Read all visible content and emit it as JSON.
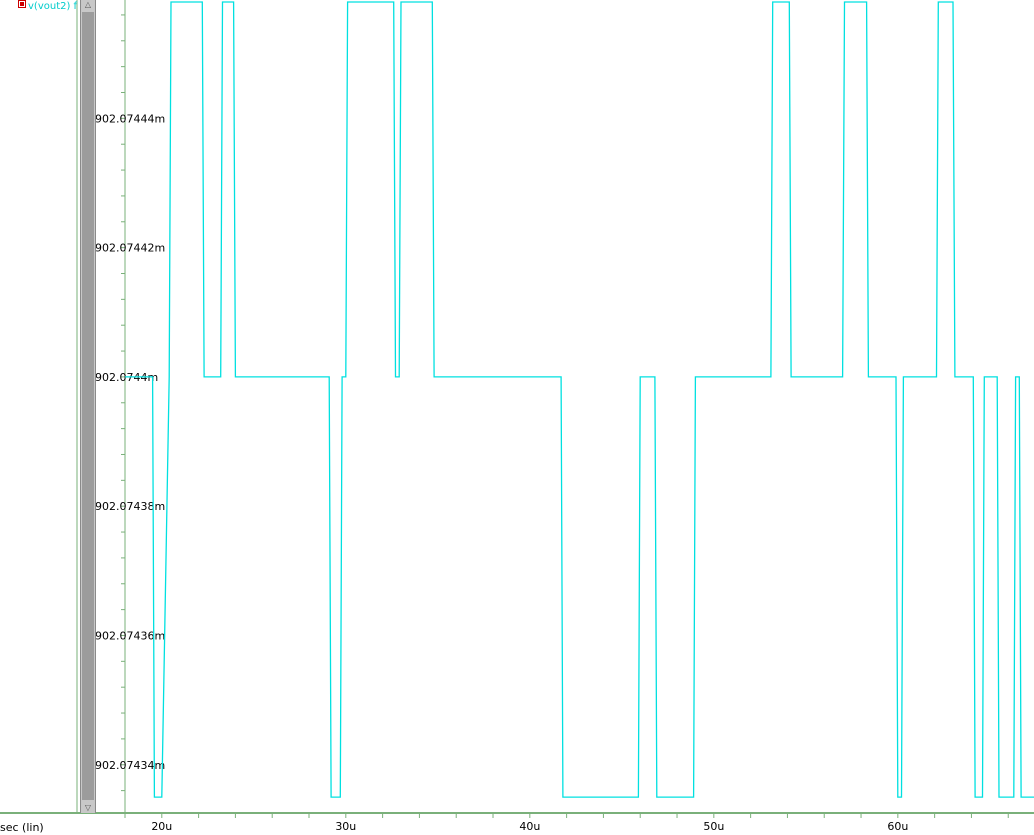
{
  "legend": {
    "label": "v(vout2) f"
  },
  "chart_data": {
    "type": "line",
    "title": "",
    "xlabel": "sec (lin)",
    "ylabel": "",
    "x_unit": "u",
    "y_unit": "m",
    "xlim": [
      18.0,
      67.4
    ],
    "ylim": [
      902.074333,
      902.074458
    ],
    "grid": false,
    "xticks": [
      20,
      30,
      40,
      50,
      60
    ],
    "xtick_labels": [
      "20u",
      "30u",
      "40u",
      "50u",
      "60u"
    ],
    "yticks": [
      902.07434,
      902.07436,
      902.07438,
      902.0744,
      902.07442,
      902.07444
    ],
    "ytick_labels": [
      "902.07434m",
      "902.07436m",
      "902.07438m",
      "902.0744m",
      "902.07442m",
      "902.07444m"
    ],
    "colors": {
      "series": "#00e0e0",
      "axis": "#7ab07a",
      "marker": "#cc0000"
    },
    "series": [
      {
        "name": "v(vout2)",
        "levels": [
          902.074458,
          902.0744,
          902.074335
        ],
        "x": [
          18.0,
          19.5,
          19.6,
          20.0,
          20.4,
          20.5,
          22.2,
          22.3,
          23.2,
          23.3,
          23.9,
          24.0,
          29.1,
          29.2,
          29.7,
          29.8,
          30.0,
          30.1,
          32.6,
          32.7,
          32.9,
          33.0,
          34.7,
          34.8,
          41.7,
          41.8,
          45.9,
          46.0,
          46.8,
          46.9,
          48.9,
          49.0,
          53.1,
          53.2,
          54.1,
          54.2,
          57.0,
          57.1,
          58.3,
          58.4,
          59.9,
          60.0,
          60.2,
          60.3,
          62.1,
          62.2,
          63.0,
          63.1,
          64.1,
          64.2,
          64.6,
          64.7,
          65.4,
          65.5,
          66.3,
          66.4,
          66.6,
          66.7,
          67.4
        ],
        "y": [
          902.0744,
          902.0744,
          902.074335,
          902.074335,
          902.0744,
          902.074458,
          902.074458,
          902.0744,
          902.0744,
          902.074458,
          902.074458,
          902.0744,
          902.0744,
          902.074335,
          902.074335,
          902.0744,
          902.0744,
          902.074458,
          902.074458,
          902.0744,
          902.0744,
          902.074458,
          902.074458,
          902.0744,
          902.0744,
          902.074335,
          902.074335,
          902.0744,
          902.0744,
          902.074335,
          902.074335,
          902.0744,
          902.0744,
          902.074458,
          902.074458,
          902.0744,
          902.0744,
          902.074458,
          902.074458,
          902.0744,
          902.0744,
          902.074335,
          902.074335,
          902.0744,
          902.0744,
          902.074458,
          902.074458,
          902.0744,
          902.0744,
          902.074335,
          902.074335,
          902.0744,
          902.0744,
          902.074335,
          902.074335,
          902.0744,
          902.0744,
          902.074335,
          902.074335
        ]
      }
    ]
  }
}
